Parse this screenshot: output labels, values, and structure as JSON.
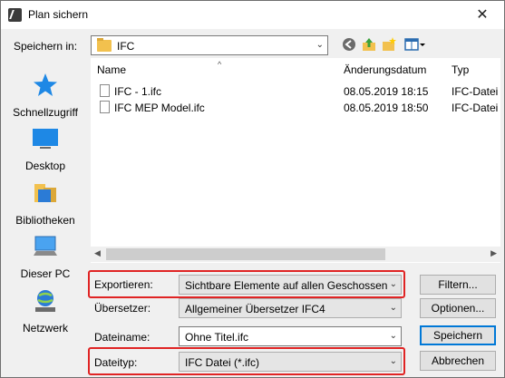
{
  "window": {
    "title": "Plan sichern",
    "close_glyph": "✕"
  },
  "toolbar": {
    "save_in_label": "Speichern in:",
    "folder": "IFC",
    "icons": [
      "back-icon",
      "up-folder-icon",
      "new-folder-icon",
      "view-menu-icon"
    ]
  },
  "places": [
    {
      "label": "Schnellzugriff",
      "icon": "star-icon"
    },
    {
      "label": "Desktop",
      "icon": "desktop-icon"
    },
    {
      "label": "Bibliotheken",
      "icon": "library-icon"
    },
    {
      "label": "Dieser PC",
      "icon": "computer-icon"
    },
    {
      "label": "Netzwerk",
      "icon": "network-icon"
    }
  ],
  "filelist": {
    "columns": [
      "Name",
      "Änderungsdatum",
      "Typ"
    ],
    "sort_indicator": "^",
    "rows": [
      {
        "name": "IFC - 1.ifc",
        "date": "08.05.2019 18:15",
        "type": "IFC-Datei"
      },
      {
        "name": "IFC MEP Model.ifc",
        "date": "08.05.2019 18:50",
        "type": "IFC-Datei"
      }
    ]
  },
  "form": {
    "export_label": "Exportieren:",
    "export_value": "Sichtbare Elemente auf allen Geschossen",
    "translator_label": "Übersetzer:",
    "translator_value": "Allgemeiner Übersetzer IFC4",
    "filename_label": "Dateiname:",
    "filename_value": "Ohne Titel.ifc",
    "filetype_label": "Dateityp:",
    "filetype_value": "IFC Datei (*.ifc)"
  },
  "buttons": {
    "filter": "Filtern...",
    "options": "Optionen...",
    "save": "Speichern",
    "cancel": "Abbrechen"
  },
  "colors": {
    "highlight": "#e02424",
    "accent": "#0078d7"
  }
}
